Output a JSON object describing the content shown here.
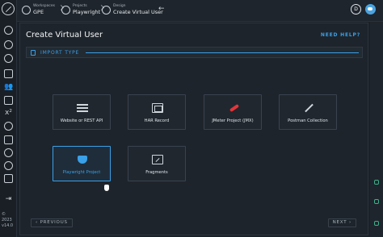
{
  "sidebar": {
    "icons": [
      "logo-icon",
      "home-icon",
      "compass-icon",
      "loop-icon",
      "scenario-icon",
      "users-icon",
      "tests-icon",
      "variables-icon",
      "links-icon",
      "monitor-icon",
      "integrations-icon",
      "config-icon",
      "grid-icon",
      "collapse-icon"
    ],
    "active": "users-icon",
    "copyright": "© 2023",
    "version": "v14.0"
  },
  "header": {
    "crumbs": [
      {
        "small": "Workspaces",
        "big": "GPE"
      },
      {
        "small": "Projects",
        "big": "Playwright"
      },
      {
        "small": "Design",
        "big": "Create Virtual User"
      }
    ],
    "back_icon": "←",
    "avatar_letter": "D"
  },
  "page": {
    "title": "Create Virtual User",
    "help_link": "NEED HELP?",
    "tab_label": "IMPORT TYPE",
    "accent": "#3aa0e8",
    "cards": [
      {
        "label": "Website or REST API",
        "icon": "list-icon",
        "selected": false
      },
      {
        "label": "HAR Record",
        "icon": "har-window-icon",
        "selected": false
      },
      {
        "label": "JMeter Project (JMX)",
        "icon": "jmeter-feather-icon",
        "selected": false
      },
      {
        "label": "Postman Collection",
        "icon": "postman-pen-icon",
        "selected": false
      },
      {
        "label": "Playwright Project",
        "icon": "playwright-masks-icon",
        "selected": true
      },
      {
        "label": "Fragments",
        "icon": "fragments-arrow-icon",
        "selected": false
      }
    ],
    "previous": "PREVIOUS",
    "next": "NEXT"
  }
}
